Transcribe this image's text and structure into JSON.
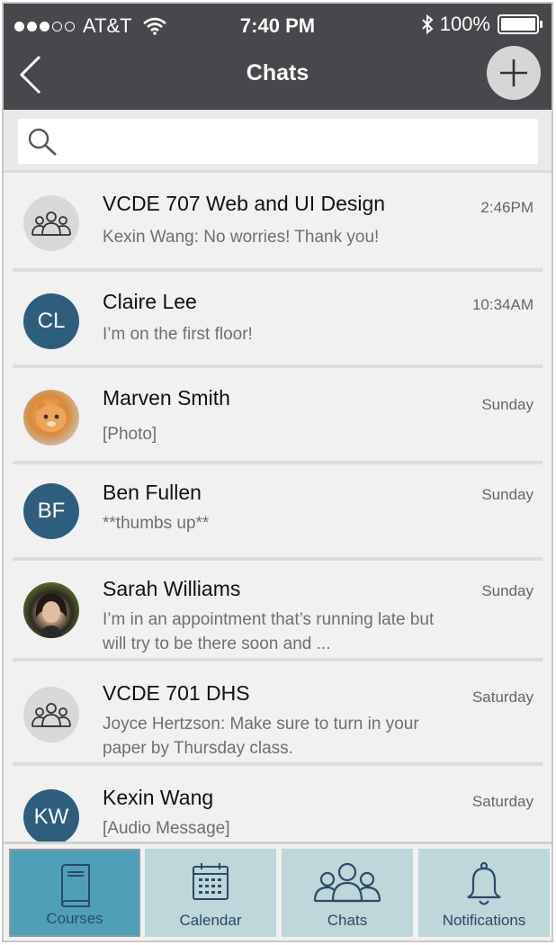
{
  "status": {
    "carrier": "AT&T",
    "time": "7:40 PM",
    "battery": "100%"
  },
  "header": {
    "title": "Chats"
  },
  "search": {
    "placeholder": ""
  },
  "chats": [
    {
      "name": "VCDE 707 Web and UI Design",
      "message": "Kexin Wang: No worries! Thank you!",
      "time": "2:46PM",
      "avatar": "group-icon"
    },
    {
      "name": "Claire Lee",
      "message": "I’m on the first floor!",
      "time": "10:34AM",
      "avatar": "CL"
    },
    {
      "name": "Marven Smith",
      "message": "[Photo]",
      "time": "Sunday",
      "avatar": "cat-photo"
    },
    {
      "name": "Ben Fullen",
      "message": "**thumbs up**",
      "time": "Sunday",
      "avatar": "BF"
    },
    {
      "name": "Sarah Williams",
      "message": "I’m in an appointment that’s running late but will try to be there soon and ...",
      "time": "Sunday",
      "avatar": "woman-photo"
    },
    {
      "name": "VCDE 701 DHS",
      "message": "Joyce Hertzson: Make sure to turn in your paper by Thursday class.",
      "time": "Saturday",
      "avatar": "group-icon"
    },
    {
      "name": "Kexin Wang",
      "message": "[Audio Message]",
      "time": "Saturday",
      "avatar": "KW"
    }
  ],
  "tabs": [
    {
      "label": "Courses",
      "icon": "book-icon",
      "active": true
    },
    {
      "label": "Calendar",
      "icon": "calendar-icon",
      "active": false
    },
    {
      "label": "Chats",
      "icon": "people-icon",
      "active": false
    },
    {
      "label": "Notifications",
      "icon": "bell-icon",
      "active": false
    }
  ],
  "colors": {
    "header_bg": "#48484c",
    "initials_avatar": "#2e5e7e",
    "tab_bg": "#bdd7da",
    "tab_active": "#4fa0b6"
  }
}
